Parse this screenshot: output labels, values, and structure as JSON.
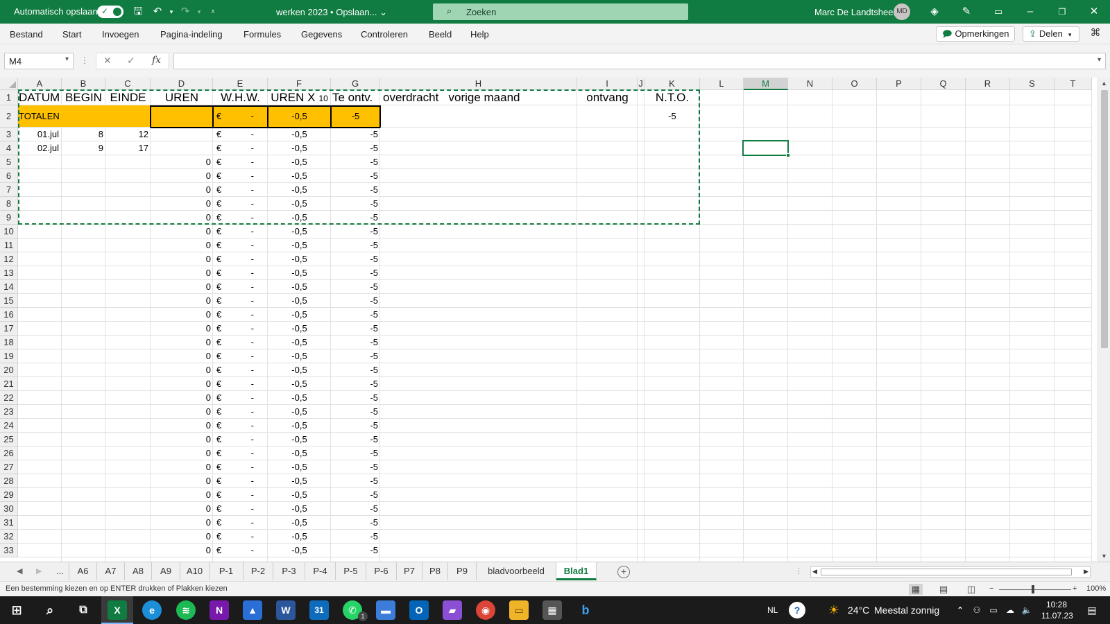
{
  "titlebar": {
    "autosave_label": "Automatisch opslaan",
    "doc_title": "werken 2023 • Opslaan... ⌄",
    "search_placeholder": "Zoeken",
    "user_name": "Marc De Landtsheer",
    "user_initials": "MD",
    "accent": "#107c41"
  },
  "menu": {
    "items": [
      "Bestand",
      "Start",
      "Invoegen",
      "Pagina-indeling",
      "Formules",
      "Gegevens",
      "Controleren",
      "Beeld",
      "Help"
    ],
    "comments_label": "Opmerkingen",
    "share_label": "Delen"
  },
  "formula_bar": {
    "name_box": "M4",
    "fx_label": "fx",
    "formula": ""
  },
  "sheet": {
    "columns": [
      "A",
      "B",
      "C",
      "D",
      "E",
      "F",
      "G",
      "H",
      "I",
      "J",
      "K",
      "L",
      "M",
      "N",
      "O",
      "P",
      "Q",
      "R",
      "S",
      "T"
    ],
    "selected_column": "M",
    "rows": [
      "1",
      "2",
      "3",
      "4",
      "5",
      "6",
      "7",
      "8",
      "9",
      "10",
      "11",
      "12",
      "13",
      "14",
      "15",
      "16",
      "17",
      "18",
      "19",
      "20",
      "21",
      "22",
      "23",
      "24",
      "25",
      "26",
      "27",
      "28",
      "29",
      "30",
      "31",
      "32",
      "33"
    ],
    "header_row": {
      "a": "DATUM",
      "b": "BEGIN",
      "c": "EINDE",
      "d": "UREN",
      "e": "W.H.W.",
      "f": "UREN X",
      "f_sub": "10",
      "g": "Te ontv.",
      "h": "overdracht   vorige maand",
      "i": "ontvang",
      "k": "N.T.O."
    },
    "totals_row": {
      "a": "TOTALEN",
      "e_cur": "€",
      "e_val": "-",
      "f": "-0,5",
      "g": "-5",
      "k": "-5"
    },
    "data_rows": [
      {
        "a": "01.jul",
        "b": "8",
        "c": "12",
        "d": "",
        "e_cur": "€",
        "e_val": "-",
        "f": "-0,5",
        "g": "-5"
      },
      {
        "a": "02.jul",
        "b": "9",
        "c": "17",
        "d": "",
        "e_cur": "€",
        "e_val": "-",
        "f": "-0,5",
        "g": "-5"
      },
      {
        "a": "",
        "b": "",
        "c": "",
        "d": "0",
        "e_cur": "€",
        "e_val": "-",
        "f": "-0,5",
        "g": "-5"
      },
      {
        "a": "",
        "b": "",
        "c": "",
        "d": "0",
        "e_cur": "€",
        "e_val": "-",
        "f": "-0,5",
        "g": "-5"
      },
      {
        "a": "",
        "b": "",
        "c": "",
        "d": "0",
        "e_cur": "€",
        "e_val": "-",
        "f": "-0,5",
        "g": "-5"
      },
      {
        "a": "",
        "b": "",
        "c": "",
        "d": "0",
        "e_cur": "€",
        "e_val": "-",
        "f": "-0,5",
        "g": "-5"
      },
      {
        "a": "",
        "b": "",
        "c": "",
        "d": "0",
        "e_cur": "€",
        "e_val": "-",
        "f": "-0,5",
        "g": "-5"
      },
      {
        "a": "",
        "b": "",
        "c": "",
        "d": "0",
        "e_cur": "€",
        "e_val": "-",
        "f": "-0,5",
        "g": "-5"
      },
      {
        "a": "",
        "b": "",
        "c": "",
        "d": "0",
        "e_cur": "€",
        "e_val": "-",
        "f": "-0,5",
        "g": "-5"
      },
      {
        "a": "",
        "b": "",
        "c": "",
        "d": "0",
        "e_cur": "€",
        "e_val": "-",
        "f": "-0,5",
        "g": "-5"
      },
      {
        "a": "",
        "b": "",
        "c": "",
        "d": "0",
        "e_cur": "€",
        "e_val": "-",
        "f": "-0,5",
        "g": "-5"
      },
      {
        "a": "",
        "b": "",
        "c": "",
        "d": "0",
        "e_cur": "€",
        "e_val": "-",
        "f": "-0,5",
        "g": "-5"
      },
      {
        "a": "",
        "b": "",
        "c": "",
        "d": "0",
        "e_cur": "€",
        "e_val": "-",
        "f": "-0,5",
        "g": "-5"
      },
      {
        "a": "",
        "b": "",
        "c": "",
        "d": "0",
        "e_cur": "€",
        "e_val": "-",
        "f": "-0,5",
        "g": "-5"
      },
      {
        "a": "",
        "b": "",
        "c": "",
        "d": "0",
        "e_cur": "€",
        "e_val": "-",
        "f": "-0,5",
        "g": "-5"
      },
      {
        "a": "",
        "b": "",
        "c": "",
        "d": "0",
        "e_cur": "€",
        "e_val": "-",
        "f": "-0,5",
        "g": "-5"
      },
      {
        "a": "",
        "b": "",
        "c": "",
        "d": "0",
        "e_cur": "€",
        "e_val": "-",
        "f": "-0,5",
        "g": "-5"
      },
      {
        "a": "",
        "b": "",
        "c": "",
        "d": "0",
        "e_cur": "€",
        "e_val": "-",
        "f": "-0,5",
        "g": "-5"
      },
      {
        "a": "",
        "b": "",
        "c": "",
        "d": "0",
        "e_cur": "€",
        "e_val": "-",
        "f": "-0,5",
        "g": "-5"
      },
      {
        "a": "",
        "b": "",
        "c": "",
        "d": "0",
        "e_cur": "€",
        "e_val": "-",
        "f": "-0,5",
        "g": "-5"
      },
      {
        "a": "",
        "b": "",
        "c": "",
        "d": "0",
        "e_cur": "€",
        "e_val": "-",
        "f": "-0,5",
        "g": "-5"
      },
      {
        "a": "",
        "b": "",
        "c": "",
        "d": "0",
        "e_cur": "€",
        "e_val": "-",
        "f": "-0,5",
        "g": "-5"
      },
      {
        "a": "",
        "b": "",
        "c": "",
        "d": "0",
        "e_cur": "€",
        "e_val": "-",
        "f": "-0,5",
        "g": "-5"
      },
      {
        "a": "",
        "b": "",
        "c": "",
        "d": "0",
        "e_cur": "€",
        "e_val": "-",
        "f": "-0,5",
        "g": "-5"
      },
      {
        "a": "",
        "b": "",
        "c": "",
        "d": "0",
        "e_cur": "€",
        "e_val": "-",
        "f": "-0,5",
        "g": "-5"
      },
      {
        "a": "",
        "b": "",
        "c": "",
        "d": "0",
        "e_cur": "€",
        "e_val": "-",
        "f": "-0,5",
        "g": "-5"
      },
      {
        "a": "",
        "b": "",
        "c": "",
        "d": "0",
        "e_cur": "€",
        "e_val": "-",
        "f": "-0,5",
        "g": "-5"
      },
      {
        "a": "",
        "b": "",
        "c": "",
        "d": "0",
        "e_cur": "€",
        "e_val": "-",
        "f": "-0,5",
        "g": "-5"
      },
      {
        "a": "",
        "b": "",
        "c": "",
        "d": "0",
        "e_cur": "€",
        "e_val": "-",
        "f": "-0,5",
        "g": "-5"
      },
      {
        "a": "",
        "b": "",
        "c": "",
        "d": "0",
        "e_cur": "€",
        "e_val": "-",
        "f": "-0,5",
        "g": "-5"
      },
      {
        "a": "",
        "b": "",
        "c": "",
        "d": "0",
        "e_cur": "€",
        "e_val": "-",
        "f": "-0,5",
        "g": "-5"
      }
    ],
    "highlight_color": "#ffc000"
  },
  "tabs": {
    "ellipsis": "...",
    "items": [
      "A6",
      "A7",
      "A8",
      "A9",
      "A10",
      "P-1",
      "P-2",
      "P-3",
      "P-4",
      "P-5",
      "P-6",
      "P7",
      "P8",
      "P9",
      "bladvoorbeeld",
      "Blad1"
    ],
    "active": "Blad1"
  },
  "status": {
    "message": "Een bestemming kiezen en op ENTER drukken of Plakken kiezen",
    "zoom_minus": "−",
    "zoom_plus": "+",
    "zoom": "100%"
  },
  "taskbar": {
    "language": "NL",
    "temperature": "24°C",
    "weather": "Meestal zonnig",
    "time": "10:28",
    "date": "11.07.23",
    "whatsapp_badge": "1"
  }
}
